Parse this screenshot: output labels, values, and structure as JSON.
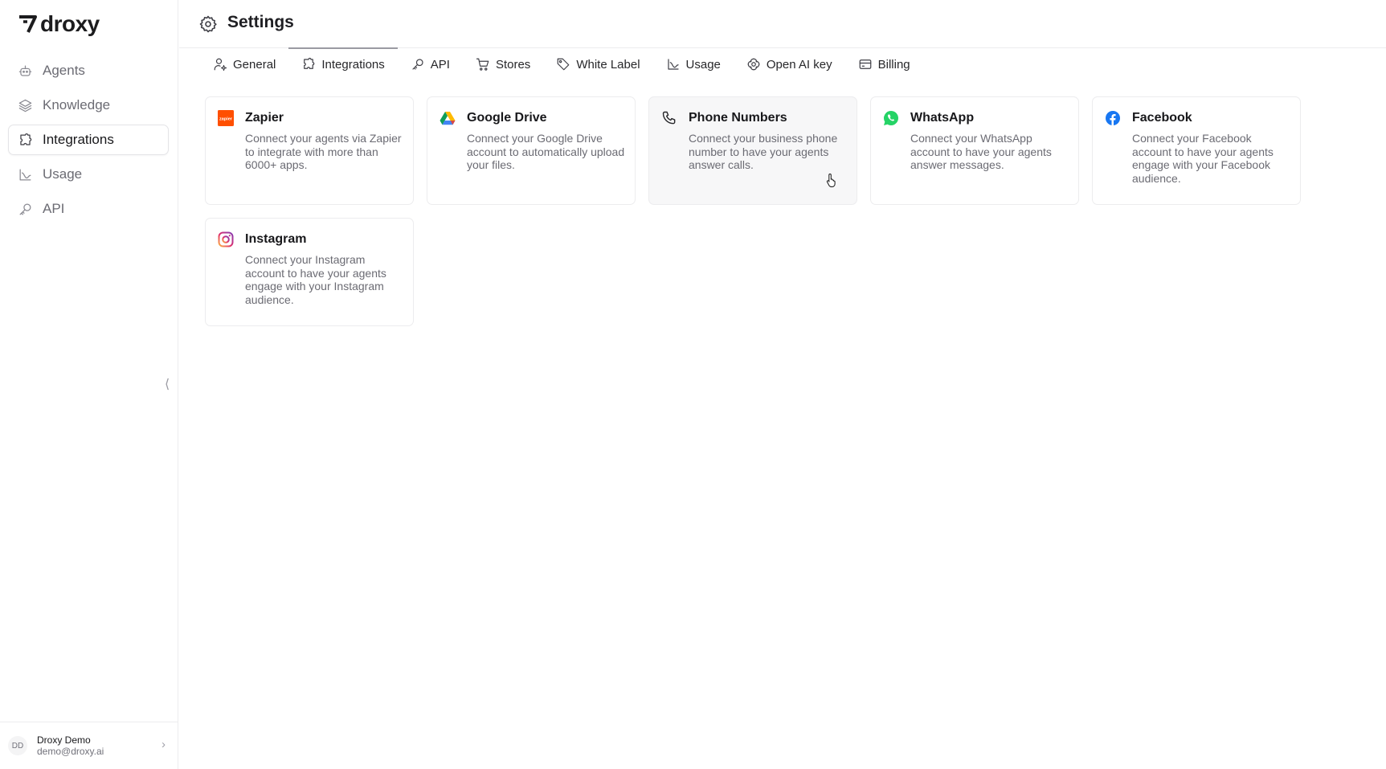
{
  "app": {
    "logo_text": "droxy"
  },
  "sidebar": {
    "items": [
      {
        "label": "Agents",
        "icon": "bot-icon",
        "active": false
      },
      {
        "label": "Knowledge",
        "icon": "layers-icon",
        "active": false
      },
      {
        "label": "Integrations",
        "icon": "puzzle-icon",
        "active": true
      },
      {
        "label": "Usage",
        "icon": "chart-line-icon",
        "active": false
      },
      {
        "label": "API",
        "icon": "key-icon",
        "active": false
      }
    ],
    "collapse_glyph": "⟨",
    "user": {
      "initials": "DD",
      "name": "Droxy Demo",
      "email": "demo@droxy.ai"
    }
  },
  "header": {
    "title": "Settings",
    "icon": "gear-icon"
  },
  "tabs": [
    {
      "label": "General",
      "icon": "user-gear-icon",
      "active": false
    },
    {
      "label": "Integrations",
      "icon": "puzzle-icon",
      "active": true
    },
    {
      "label": "API",
      "icon": "key-icon",
      "active": false
    },
    {
      "label": "Stores",
      "icon": "cart-icon",
      "active": false
    },
    {
      "label": "White Label",
      "icon": "tag-icon",
      "active": false
    },
    {
      "label": "Usage",
      "icon": "chart-line-icon",
      "active": false
    },
    {
      "label": "Open AI key",
      "icon": "openai-icon",
      "active": false
    },
    {
      "label": "Billing",
      "icon": "credit-card-icon",
      "active": false
    }
  ],
  "integrations": [
    {
      "title": "Zapier",
      "description": "Connect your agents via Zapier to integrate with more than 6000+ apps.",
      "icon": "zapier-icon",
      "color": "#ff4f00",
      "logo_text": "zapier"
    },
    {
      "title": "Google Drive",
      "description": "Connect your Google Drive account to automatically upload your files.",
      "icon": "google-drive-icon"
    },
    {
      "title": "Phone Numbers",
      "description": "Connect your business phone number to have your agents answer calls.",
      "icon": "phone-icon"
    },
    {
      "title": "WhatsApp",
      "description": "Connect your WhatsApp account to have your agents answer messages.",
      "icon": "whatsapp-icon",
      "color": "#25d366"
    },
    {
      "title": "Facebook",
      "description": "Connect your Facebook account to have your agents engage with your Facebook audience.",
      "icon": "facebook-icon",
      "color": "#1877f2"
    },
    {
      "title": "Instagram",
      "description": "Connect your Instagram account to have your agents engage with your Instagram audience.",
      "icon": "instagram-icon"
    }
  ]
}
